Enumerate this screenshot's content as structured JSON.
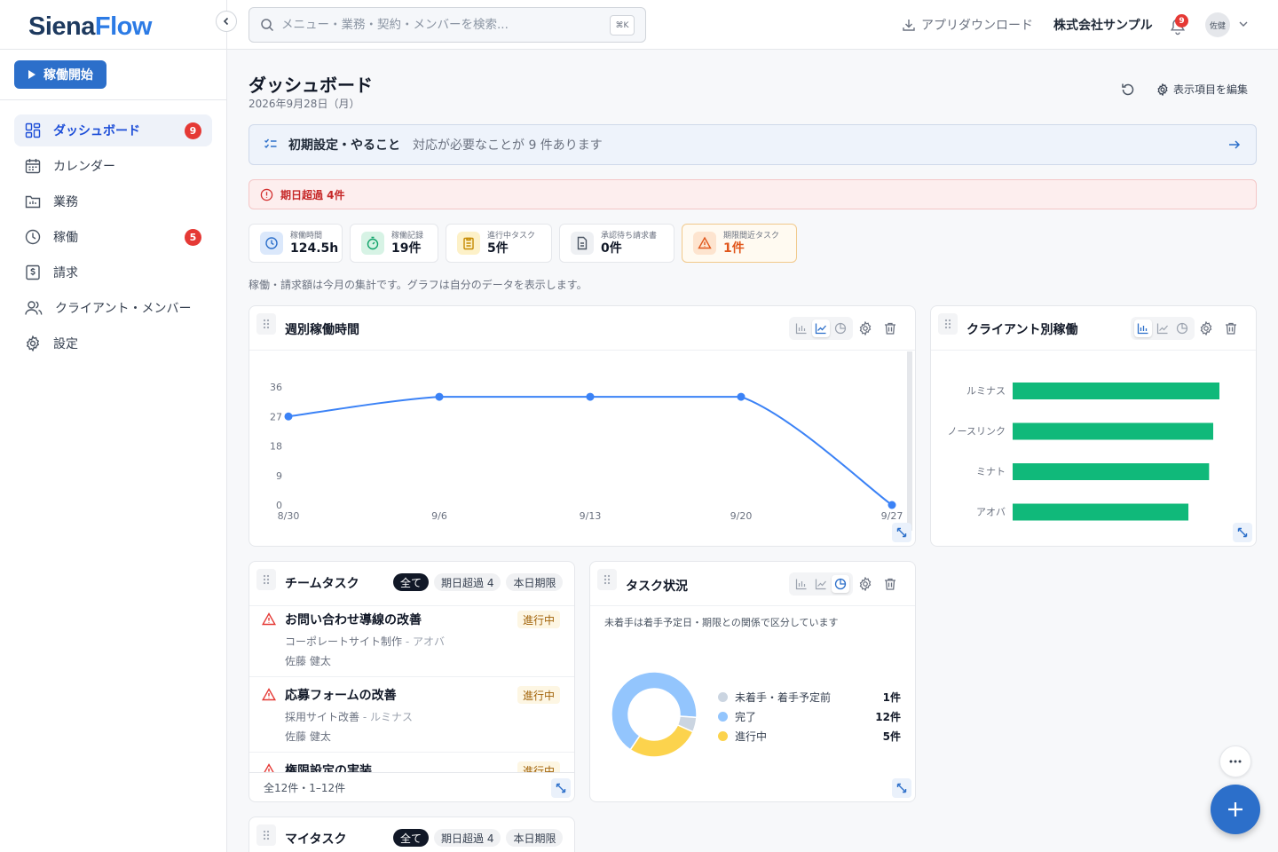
{
  "app": {
    "logo_part1": "Siena",
    "logo_part2": "Flow"
  },
  "sidebar": {
    "start_label": "稼働開始",
    "items": [
      {
        "label": "ダッシュボード",
        "badge": "9"
      },
      {
        "label": "カレンダー"
      },
      {
        "label": "業務"
      },
      {
        "label": "稼働",
        "badge": "5"
      },
      {
        "label": "請求"
      },
      {
        "label": "クライアント・メンバー"
      },
      {
        "label": "設定"
      }
    ]
  },
  "topbar": {
    "search_placeholder": "メニュー・業務・契約・メンバーを検索...",
    "search_shortcut": "⌘K",
    "app_download": "アプリダウンロード",
    "company": "株式会社サンプル",
    "notification_count": "9",
    "avatar": "佐健"
  },
  "page": {
    "title": "ダッシュボード",
    "date": "2026年9月28日（月）",
    "edit_items": "表示項目を編集",
    "setup_title": "初期設定・やること",
    "setup_sub": "対応が必要なことが 9 件あります",
    "overdue_alert": "期日超過 4件",
    "note": "稼働・請求額は今月の集計です。グラフは自分のデータを表示します。"
  },
  "stats": [
    {
      "label": "稼働時間",
      "value": "124.5h"
    },
    {
      "label": "稼働記録",
      "value": "19件"
    },
    {
      "label": "進行中タスク",
      "value": "5件"
    },
    {
      "label": "承認待ち請求書",
      "value": "0件"
    },
    {
      "label": "期限間近タスク",
      "value": "1件"
    }
  ],
  "weekly": {
    "title": "週別稼働時間",
    "chart_data": {
      "type": "line",
      "x": [
        "8/30",
        "9/6",
        "9/13",
        "9/20",
        "9/27"
      ],
      "values": [
        27,
        33,
        33,
        33,
        0
      ],
      "yticks": [
        0,
        9,
        18,
        27,
        36
      ],
      "ylim": [
        0,
        36
      ],
      "grid": false,
      "color": "#3b82f6"
    }
  },
  "client_chart": {
    "title": "クライアント別稼働",
    "chart_data": {
      "type": "bar",
      "orientation": "horizontal",
      "categories": [
        "ルミナス",
        "ノースリンク",
        "ミナト",
        "アオバ"
      ],
      "values": [
        100,
        97,
        95,
        85
      ],
      "color": "#10b97a"
    }
  },
  "team_tasks": {
    "title": "チームタスク",
    "filters": [
      "全て",
      "期日超過 4",
      "本日期限"
    ],
    "items": [
      {
        "title": "お問い合わせ導線の改善",
        "project": "コーポレートサイト制作",
        "client": "アオバ",
        "assignee": "佐藤 健太",
        "status": "進行中"
      },
      {
        "title": "応募フォームの改善",
        "project": "採用サイト改善",
        "client": "ルミナス",
        "assignee": "佐藤 健太",
        "status": "進行中"
      },
      {
        "title": "権限設定の実装",
        "project": "",
        "client": "",
        "assignee": "",
        "status": "進行中"
      }
    ],
    "footer": "全12件・1–12件",
    "separator": "-"
  },
  "task_status": {
    "title": "タスク状況",
    "note": "未着手は着手予定日・期限との関係で区分しています",
    "chart_data": {
      "type": "pie",
      "categories": [
        "未着手・着手予定前",
        "完了",
        "進行中"
      ],
      "values": [
        1,
        12,
        5
      ],
      "value_labels": [
        "1件",
        "12件",
        "5件"
      ],
      "colors": [
        "#cbd5e1",
        "#93c5fd",
        "#fcd34d"
      ]
    }
  },
  "my_tasks": {
    "title": "マイタスク",
    "filters": [
      "全て",
      "期日超過 4",
      "本日期限"
    ]
  }
}
